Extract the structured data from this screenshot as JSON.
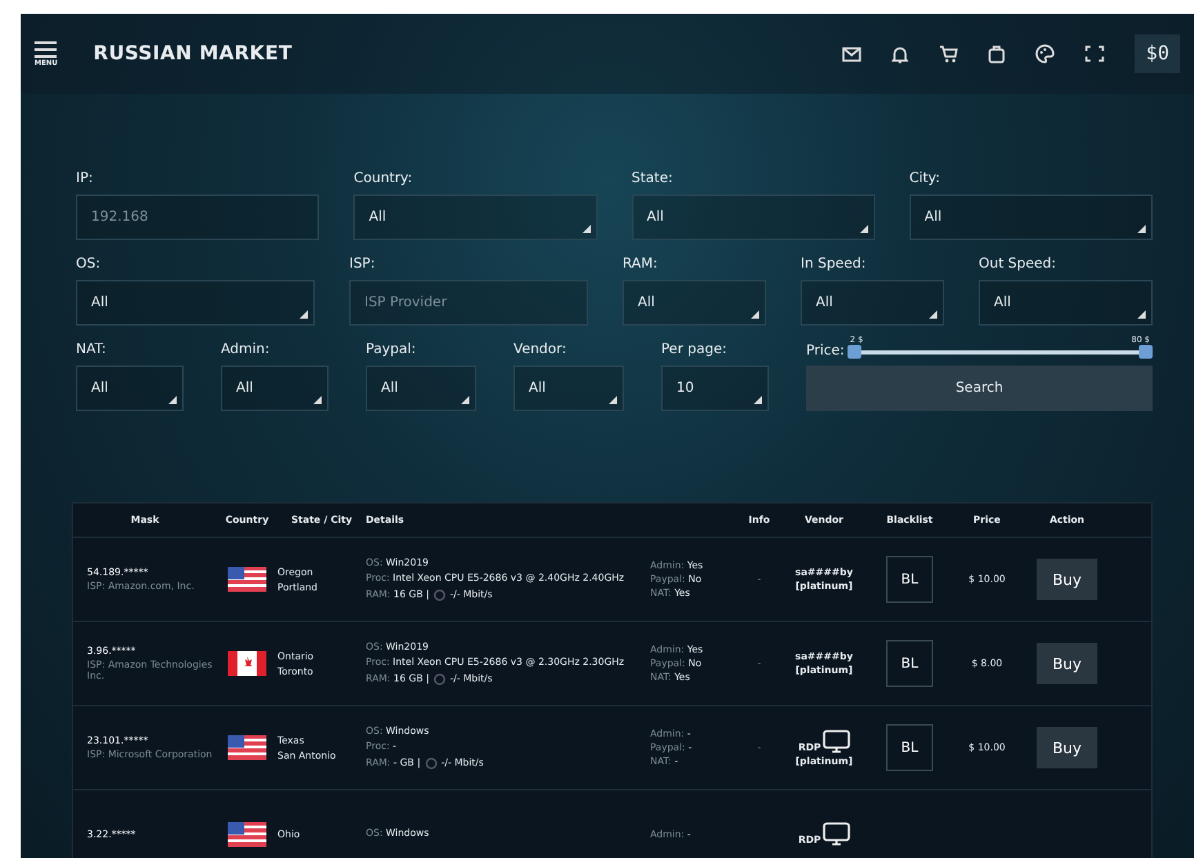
{
  "header": {
    "menu_label": "MENU",
    "brand": "RUSSIAN MARKET",
    "balance": "$0"
  },
  "filters": [
    [
      {
        "label": "IP:",
        "kind": "input",
        "placeholder": "192.168"
      },
      {
        "label": "Country:",
        "kind": "select",
        "value": "All"
      },
      {
        "label": "State:",
        "kind": "select",
        "value": "All"
      },
      {
        "label": "City:",
        "kind": "select",
        "value": "All"
      }
    ],
    [
      {
        "label": "OS:",
        "kind": "select",
        "value": "All"
      },
      {
        "label": "ISP:",
        "kind": "input",
        "placeholder": "ISP Provider"
      },
      {
        "label": "RAM:",
        "kind": "select",
        "value": "All"
      },
      {
        "label": "In Speed:",
        "kind": "select",
        "value": "All"
      },
      {
        "label": "Out Speed:",
        "kind": "select",
        "value": "All"
      }
    ],
    [
      {
        "label": "NAT:",
        "kind": "select",
        "value": "All"
      },
      {
        "label": "Admin:",
        "kind": "select",
        "value": "All"
      },
      {
        "label": "Paypal:",
        "kind": "select",
        "value": "All"
      },
      {
        "label": "Vendor:",
        "kind": "select",
        "value": "All"
      },
      {
        "label": "Per page:",
        "kind": "select",
        "value": "10"
      },
      {
        "label": "Price:",
        "kind": "price",
        "min_label": "2 $",
        "max_label": "80 $",
        "level": 1,
        "button": "Search"
      }
    ]
  ],
  "table": {
    "columns": [
      "Mask",
      "Country",
      "State / City",
      "Details",
      "",
      "Info",
      "Vendor",
      "Blacklist",
      "Price",
      "Action"
    ],
    "rows": [
      {
        "mask": "54.189.*****",
        "isp": "ISP: Amazon.com, Inc.",
        "flag": {
          "kind": "us"
        },
        "state": "Oregon",
        "city": "Portland",
        "os_label": "OS:",
        "os": "Win2019",
        "proc_label": "Proc:",
        "proc": "Intel Xeon CPU E5-2686 v3 @ 2.40GHz 2.40GHz",
        "ram_label": "RAM:",
        "ram": "16 GB |",
        "speed": "-/- Mbit/s",
        "admin_label": "Admin:",
        "admin": "Yes",
        "paypal_label": "Paypal:",
        "paypal": "No",
        "nat_label": "NAT:",
        "nat": "Yes",
        "info": "-",
        "vendor": {
          "kind": "name",
          "text": "sa####by"
        },
        "tier": "[platinum]",
        "blacklist": "BL",
        "price": "$ 10.00",
        "action": "Buy"
      },
      {
        "mask": "3.96.*****",
        "isp": "ISP: Amazon Technologies Inc.",
        "flag": {
          "kind": "ca"
        },
        "state": "Ontario",
        "city": "Toronto",
        "os_label": "OS:",
        "os": "Win2019",
        "proc_label": "Proc:",
        "proc": "Intel Xeon CPU E5-2686 v3 @ 2.30GHz 2.30GHz",
        "ram_label": "RAM:",
        "ram": "16 GB |",
        "speed": "-/- Mbit/s",
        "admin_label": "Admin:",
        "admin": "Yes",
        "paypal_label": "Paypal:",
        "paypal": "No",
        "nat_label": "NAT:",
        "nat": "Yes",
        "info": "-",
        "vendor": {
          "kind": "name",
          "text": "sa####by"
        },
        "tier": "[platinum]",
        "blacklist": "BL",
        "price": "$ 8.00",
        "action": "Buy"
      },
      {
        "mask": "23.101.*****",
        "isp": "ISP: Microsoft Corporation",
        "flag": {
          "kind": "us"
        },
        "state": "Texas",
        "city": "San Antonio",
        "os_label": "OS:",
        "os": "Windows",
        "proc_label": "Proc:",
        "proc": "-",
        "ram_label": "RAM:",
        "ram": "- GB |",
        "speed": "-/- Mbit/s",
        "admin_label": "Admin:",
        "admin": "-",
        "paypal_label": "Paypal:",
        "paypal": "-",
        "nat_label": "NAT:",
        "nat": "-",
        "info": "-",
        "vendor": {
          "kind": "rdp",
          "text": "RDP"
        },
        "tier": "[platinum]",
        "blacklist": "BL",
        "price": "$ 10.00",
        "action": "Buy"
      },
      {
        "mask": "3.22.*****",
        "flag": {
          "kind": "us"
        },
        "state": "Ohio",
        "os_label": "OS:",
        "os": "Windows",
        "admin_label": "Admin:",
        "admin": "-",
        "vendor": {
          "kind": "rdp",
          "text": "RDP"
        }
      }
    ]
  }
}
